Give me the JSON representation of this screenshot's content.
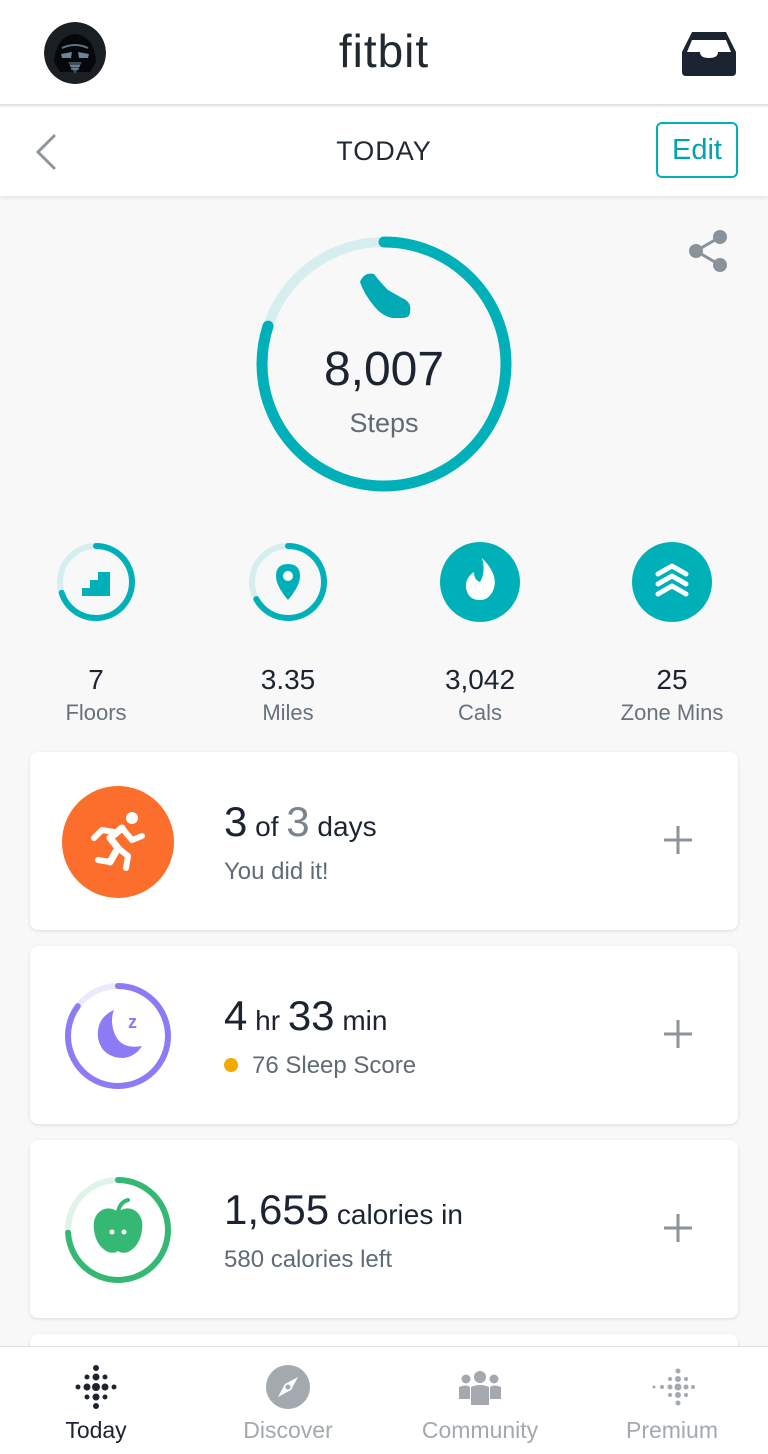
{
  "header": {
    "brand": "fitbit",
    "avatar_icon": "darth-vader-avatar",
    "inbox_icon": "inbox-icon"
  },
  "subheader": {
    "title": "TODAY",
    "edit_label": "Edit",
    "back_icon": "chevron-left-icon"
  },
  "steps": {
    "value": "8,007",
    "label": "Steps",
    "progress": 0.8,
    "icon": "shoe-icon"
  },
  "stats": [
    {
      "value": "7",
      "label": "Floors",
      "icon": "stairs-icon",
      "progress": 0.7
    },
    {
      "value": "3.35",
      "label": "Miles",
      "icon": "location-pin-icon",
      "progress": 0.67
    },
    {
      "value": "3,042",
      "label": "Cals",
      "icon": "flame-icon",
      "progress": 1.0
    },
    {
      "value": "25",
      "label": "Zone Mins",
      "icon": "zone-chevrons-icon",
      "progress": 1.0
    }
  ],
  "cards": {
    "exercise": {
      "num1": "3",
      "mid": "of",
      "num2": "3",
      "unit": "days",
      "sub": "You did it!",
      "icon": "running-person-icon"
    },
    "sleep": {
      "num1": "4",
      "unit1": "hr",
      "num2": "33",
      "unit2": "min",
      "sub": "76 Sleep Score",
      "icon": "moon-icon",
      "progress": 0.85
    },
    "food": {
      "num": "1,655",
      "unit": "calories in",
      "sub": "580 calories left",
      "icon": "apple-icon",
      "progress": 0.74
    }
  },
  "nav": [
    {
      "label": "Today",
      "icon": "fitbit-dots-icon",
      "active": true
    },
    {
      "label": "Discover",
      "icon": "compass-icon",
      "active": false
    },
    {
      "label": "Community",
      "icon": "community-icon",
      "active": false
    },
    {
      "label": "Premium",
      "icon": "premium-dots-icon",
      "active": false
    }
  ],
  "colors": {
    "teal": "#00b0b9",
    "teal_light": "#d7eef0",
    "orange": "#fb6e2b",
    "purple": "#8b7cf6",
    "green": "#35b873",
    "sleep_dot": "#f2a900"
  }
}
